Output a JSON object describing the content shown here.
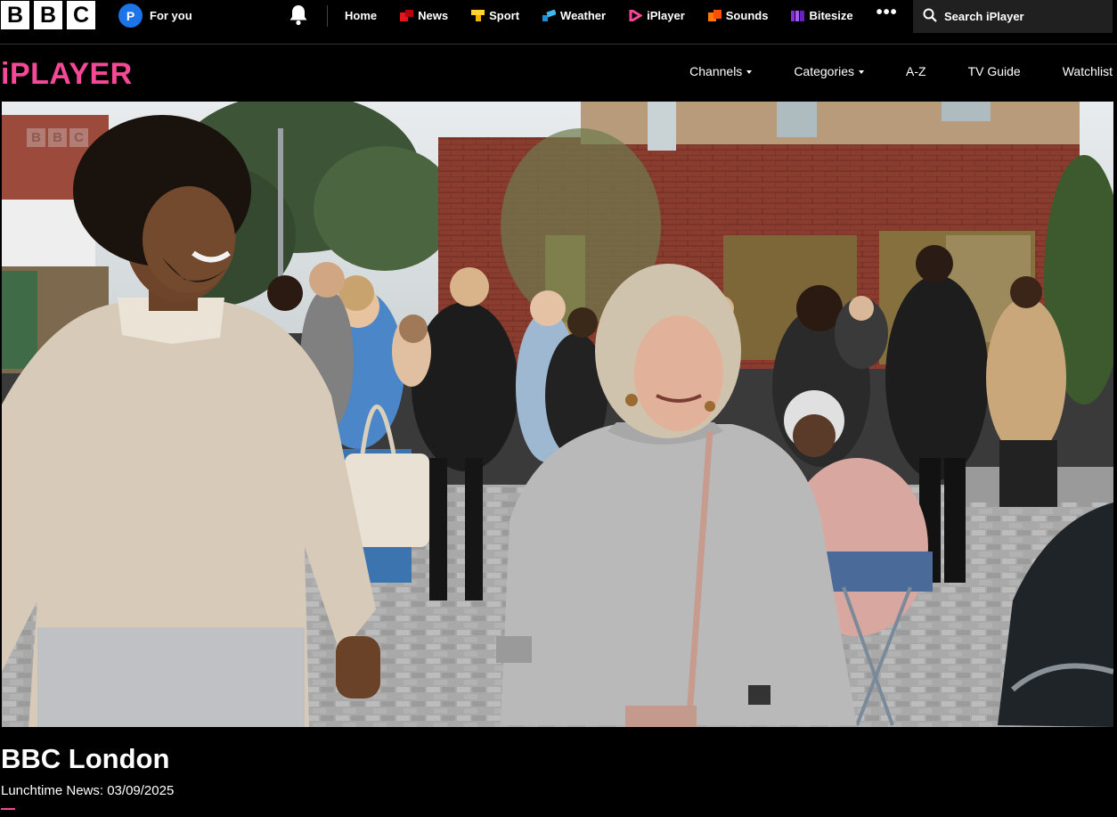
{
  "global_nav": {
    "logo_letters": [
      "B",
      "B",
      "C"
    ],
    "account": {
      "initial": "P",
      "label": "For you"
    },
    "items": [
      {
        "label": "Home",
        "icon": "none",
        "color": ""
      },
      {
        "label": "News",
        "icon": "news-icon",
        "color": "#e3161c"
      },
      {
        "label": "Sport",
        "icon": "sport-icon",
        "color": "#ffd230"
      },
      {
        "label": "Weather",
        "icon": "weather-icon",
        "color": "#1d8fd6"
      },
      {
        "label": "iPlayer",
        "icon": "iplayer-icon",
        "color": "#f54997"
      },
      {
        "label": "Sounds",
        "icon": "sounds-icon",
        "color": "#ff4f00"
      },
      {
        "label": "Bitesize",
        "icon": "bitesize-icon",
        "color": "#8a2be2"
      }
    ],
    "search_label": "Search iPlayer"
  },
  "iplayer_nav": {
    "logo": "iPLAYER",
    "items": [
      {
        "label": "Channels",
        "dropdown": true
      },
      {
        "label": "Categories",
        "dropdown": true
      },
      {
        "label": "A-Z",
        "dropdown": false
      },
      {
        "label": "TV Guide",
        "dropdown": false
      },
      {
        "label": "Watchlist",
        "dropdown": false
      }
    ]
  },
  "player": {
    "watermark_letters": [
      "B",
      "B",
      "C"
    ]
  },
  "programme": {
    "title": "BBC London",
    "subtitle": "Lunchtime News: 03/09/2025"
  },
  "colors": {
    "accent": "#f54997",
    "background": "#000000"
  }
}
